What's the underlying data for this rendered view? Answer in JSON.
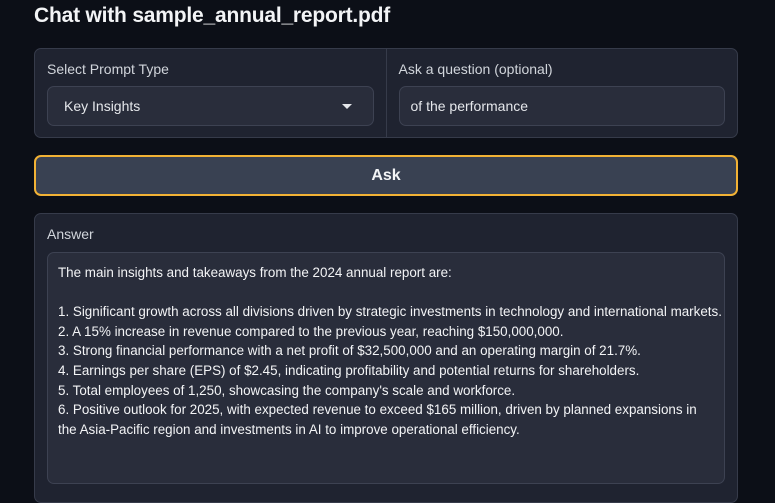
{
  "page": {
    "title": "Chat with sample_annual_report.pdf"
  },
  "prompt_type": {
    "label": "Select Prompt Type",
    "selected": "Key Insights"
  },
  "question": {
    "label": "Ask a question (optional)",
    "value": "of the performance"
  },
  "ask_button": {
    "label": "Ask"
  },
  "answer": {
    "label": "Answer",
    "intro": "The main insights and takeaways from the 2024 annual report are:",
    "items": [
      "1. Significant growth across all divisions driven by strategic investments in technology and international markets.",
      "2. A 15% increase in revenue compared to the previous year, reaching $150,000,000.",
      "3. Strong financial performance with a net profit of $32,500,000 and an operating margin of 21.7%.",
      "4. Earnings per share (EPS) of $2.45, indicating profitability and potential returns for shareholders.",
      "5. Total employees of 1,250, showcasing the company's scale and workforce.",
      "6. Positive outlook for 2025, with expected revenue to exceed $165 million, driven by planned expansions in the Asia-Pacific region and investments in AI to improve operational efficiency."
    ]
  },
  "colors": {
    "background": "#0c0f17",
    "panel": "#1f2330",
    "accent_border": "#f2b235"
  }
}
